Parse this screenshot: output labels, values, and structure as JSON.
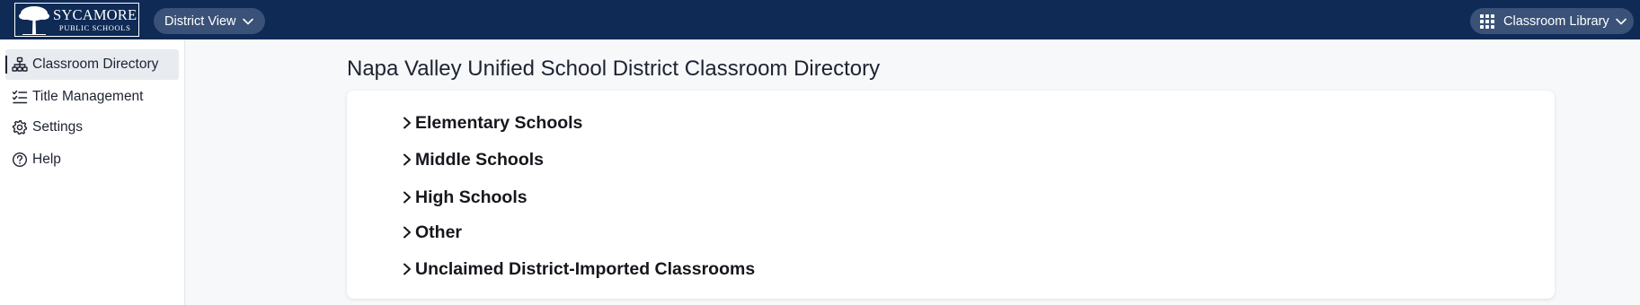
{
  "header": {
    "logo": {
      "title": "SYCAMORE",
      "subtitle": "PUBLIC SCHOOLS",
      "icon": "tree-logo-icon"
    },
    "district_view_label": "District View",
    "library_label": "Classroom Library",
    "background_color": "#0f2b55",
    "pill_color": "#3a5278"
  },
  "sidebar": {
    "items": [
      {
        "label": "Classroom Directory",
        "icon": "org-chart-icon",
        "active": true
      },
      {
        "label": "Title Management",
        "icon": "checklist-icon",
        "active": false
      },
      {
        "label": "Settings",
        "icon": "gear-icon",
        "active": false
      },
      {
        "label": "Help",
        "icon": "question-circle-icon",
        "active": false
      }
    ]
  },
  "main": {
    "title": "Napa Valley Unified School District Classroom Directory",
    "sections": [
      {
        "label": "Elementary Schools",
        "expanded": false
      },
      {
        "label": "Middle Schools",
        "expanded": false
      },
      {
        "label": "High Schools",
        "expanded": false
      },
      {
        "label": "Other",
        "expanded": false
      },
      {
        "label": "Unclaimed District-Imported Classrooms",
        "expanded": false
      }
    ]
  }
}
